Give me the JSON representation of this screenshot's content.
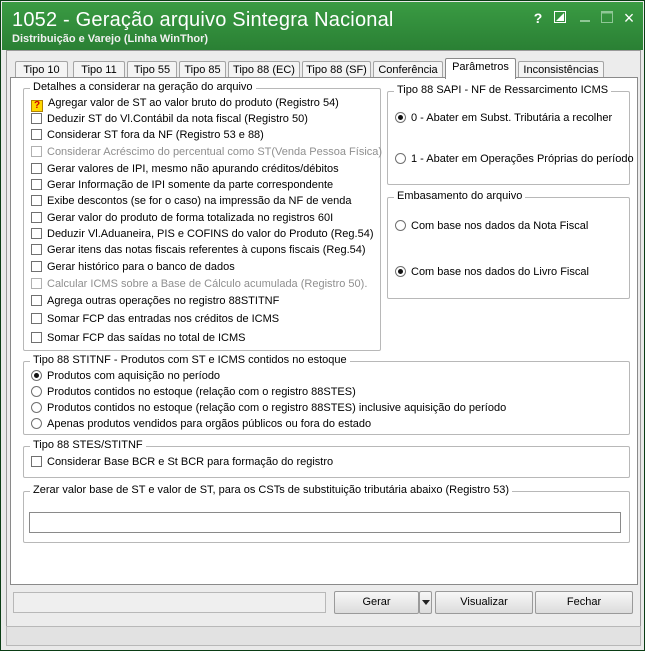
{
  "window": {
    "title": "1052 - Geração arquivo Sintegra Nacional",
    "subtitle": "Distribuição e Varejo (Linha WinThor)",
    "help_icon": "?",
    "restore_icon": "restore-icon",
    "minimize_icon": "minimize-icon",
    "maximize_icon": "maximize-icon",
    "close_icon": "×"
  },
  "tabs": [
    {
      "label": "Tipo 10"
    },
    {
      "label": "Tipo 11"
    },
    {
      "label": "Tipo 55"
    },
    {
      "label": "Tipo 85"
    },
    {
      "label": "Tipo 88 (EC)"
    },
    {
      "label": "Tipo 88 (SF)"
    },
    {
      "label": "Conferência"
    },
    {
      "label": "Parâmetros"
    },
    {
      "label": "Inconsistências"
    }
  ],
  "active_tab": "Parâmetros",
  "detalhes": {
    "title": "Detalhes a considerar na geração do arquivo",
    "items": [
      {
        "label": "Agregar valor de ST ao valor bruto do produto (Registro 54)"
      },
      {
        "label": "Deduzir ST do Vl.Contábil da nota fiscal (Registro 50)"
      },
      {
        "label": "Considerar ST fora da NF (Registro 53 e 88)"
      },
      {
        "label": "Considerar Acréscimo do percentual como ST(Venda Pessoa Física)"
      },
      {
        "label": "Gerar valores de IPI, mesmo não apurando créditos/débitos"
      },
      {
        "label": "Gerar Informação de IPI somente da parte correspondente"
      },
      {
        "label": "Exibe descontos (se for o caso) na impressão da NF de venda"
      },
      {
        "label": "Gerar valor do produto de forma totalizada no registros 60I"
      },
      {
        "label": "Deduzir Vl.Aduaneira, PIS e COFINS do valor do Produto (Reg.54)"
      },
      {
        "label": "Gerar itens das notas fiscais referentes à cupons fiscais (Reg.54)"
      },
      {
        "label": "Gerar histórico para o banco de dados"
      },
      {
        "label": "Calcular ICMS sobre a Base de Cálculo acumulada (Registro 50)."
      },
      {
        "label": "Agrega outras operações no registro 88STITNF"
      },
      {
        "label": "Somar FCP das entradas nos créditos de ICMS"
      },
      {
        "label": "Somar FCP das saídas no total de ICMS"
      }
    ]
  },
  "sapi": {
    "title": "Tipo 88  SAPI - NF de Ressarcimento ICMS",
    "options": [
      {
        "label": "0 - Abater em Subst. Tributária a recolher"
      },
      {
        "label": "1 - Abater em Operações Próprias do período"
      }
    ]
  },
  "embasamento": {
    "title": "Embasamento do arquivo",
    "options": [
      {
        "label": "Com base nos dados da Nota Fiscal"
      },
      {
        "label": "Com base nos dados do Livro Fiscal"
      }
    ]
  },
  "stitnf": {
    "title": "Tipo 88 STITNF - Produtos com ST e ICMS contidos no estoque",
    "options": [
      {
        "label": "Produtos com aquisição no período"
      },
      {
        "label": "Produtos contidos no estoque (relação com o registro 88STES)"
      },
      {
        "label": "Produtos contidos no estoque (relação com o registro 88STES) inclusive aquisição do período"
      },
      {
        "label": "Apenas produtos vendidos para orgãos públicos ou fora do estado"
      }
    ]
  },
  "stes": {
    "title": "Tipo 88 STES/STITNF",
    "checkbox": "Considerar Base BCR e St BCR para formação do registro"
  },
  "zerar": {
    "title": "Zerar valor base de ST e valor de ST, para os CSTs de substituição tributária abaixo (Registro 53)",
    "value": ""
  },
  "buttons": {
    "gerar": "Gerar",
    "visualizar": "Visualizar",
    "fechar": "Fechar"
  }
}
